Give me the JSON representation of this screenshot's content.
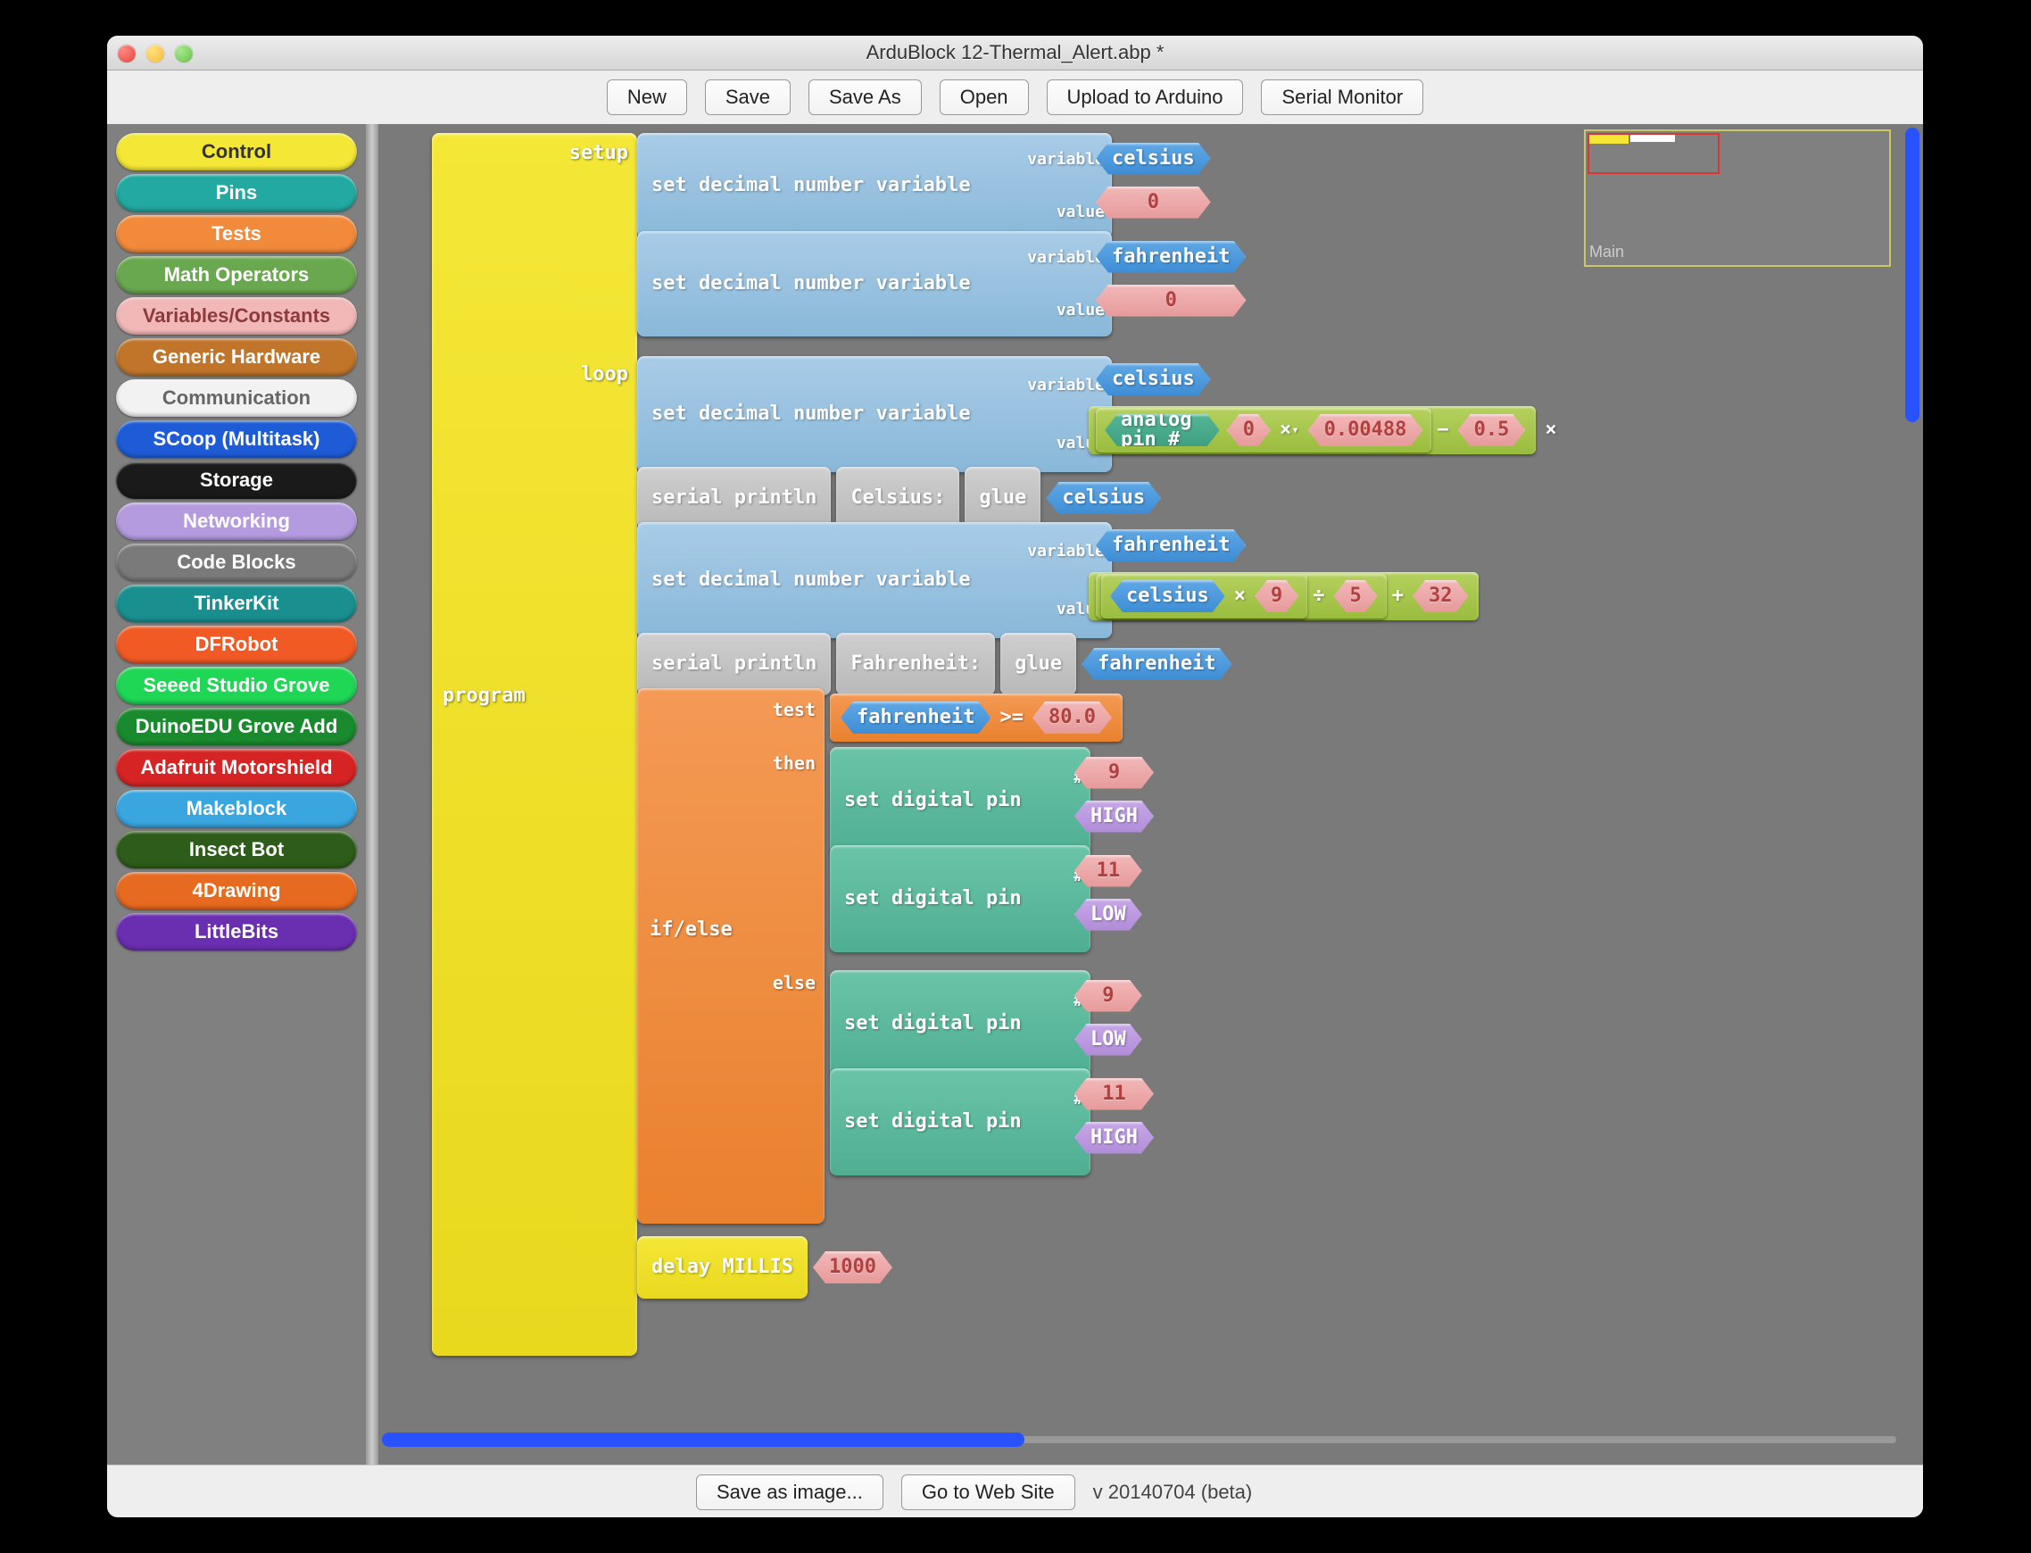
{
  "window": {
    "title": "ArduBlock 12-Thermal_Alert.abp *"
  },
  "toolbar": {
    "new": "New",
    "save": "Save",
    "saveas": "Save As",
    "open": "Open",
    "upload": "Upload to Arduino",
    "serial": "Serial Monitor"
  },
  "footer": {
    "saveimg": "Save as image...",
    "gotoweb": "Go to Web Site",
    "version": "v 20140704 (beta)"
  },
  "minimap": {
    "label": "Main"
  },
  "palette": [
    {
      "label": "Control",
      "bg": "#f5e736",
      "fg": "#333333"
    },
    {
      "label": "Pins",
      "bg": "#22a9a1",
      "fg": "#ffffff"
    },
    {
      "label": "Tests",
      "bg": "#f18a3b",
      "fg": "#ffffff"
    },
    {
      "label": "Math Operators",
      "bg": "#6aa84f",
      "fg": "#ffffff"
    },
    {
      "label": "Variables/Constants",
      "bg": "#f2b8b8",
      "fg": "#8c3a3a"
    },
    {
      "label": "Generic Hardware",
      "bg": "#c0752a",
      "fg": "#ffffff"
    },
    {
      "label": "Communication",
      "bg": "#f2f2f2",
      "fg": "#666666"
    },
    {
      "label": "SCoop (Multitask)",
      "bg": "#1e5bd6",
      "fg": "#ffffff"
    },
    {
      "label": "Storage",
      "bg": "#1a1a1a",
      "fg": "#ffffff"
    },
    {
      "label": "Networking",
      "bg": "#b49be0",
      "fg": "#ffffff"
    },
    {
      "label": "Code Blocks",
      "bg": "#7a7a7a",
      "fg": "#ffffff"
    },
    {
      "label": "TinkerKit",
      "bg": "#1a8f8f",
      "fg": "#ffffff"
    },
    {
      "label": "DFRobot",
      "bg": "#f15a24",
      "fg": "#ffffff"
    },
    {
      "label": "Seeed Studio Grove",
      "bg": "#1fd655",
      "fg": "#ffffff"
    },
    {
      "label": "DuinoEDU Grove Add",
      "bg": "#1a8a2e",
      "fg": "#ffffff"
    },
    {
      "label": "Adafruit Motorshield",
      "bg": "#d62424",
      "fg": "#ffffff"
    },
    {
      "label": "Makeblock",
      "bg": "#3aa6e0",
      "fg": "#ffffff"
    },
    {
      "label": "Insect Bot",
      "bg": "#2e5c1a",
      "fg": "#ffffff"
    },
    {
      "label": "4Drawing",
      "bg": "#e66a1f",
      "fg": "#ffffff"
    },
    {
      "label": "LittleBits",
      "bg": "#6a2eb0",
      "fg": "#ffffff"
    }
  ],
  "labels": {
    "program": "program",
    "setup": "setup",
    "loop": "loop",
    "setDecVar": "set decimal number variable",
    "variable": "variable",
    "value": "value",
    "serialPrintln": "serial println",
    "glue": "glue",
    "celsiusStr": "Celsius:",
    "fahrenheitStr": "Fahrenheit:",
    "analogPin": "analog pin #",
    "setDigitalPin": "set digital pin",
    "pinHash": "#",
    "delayMillis": "delay MILLIS",
    "ifelse": "if/else",
    "test": "test",
    "then": "then",
    "else": "else",
    "gte": ">=",
    "minus": "−",
    "plus": "+",
    "times": "×",
    "div": "÷",
    "triangle": "▾"
  },
  "vars": {
    "celsius": "celsius",
    "fahrenheit": "fahrenheit"
  },
  "vals": {
    "zero": "0",
    "analogPinNum": "0",
    "factor": "0.00488",
    "offset": "0.5",
    "mult": "9",
    "div": "5",
    "add": "32",
    "threshold": "80.0",
    "pin9": "9",
    "pin11": "11",
    "high": "HIGH",
    "low": "LOW",
    "delay": "1000"
  }
}
